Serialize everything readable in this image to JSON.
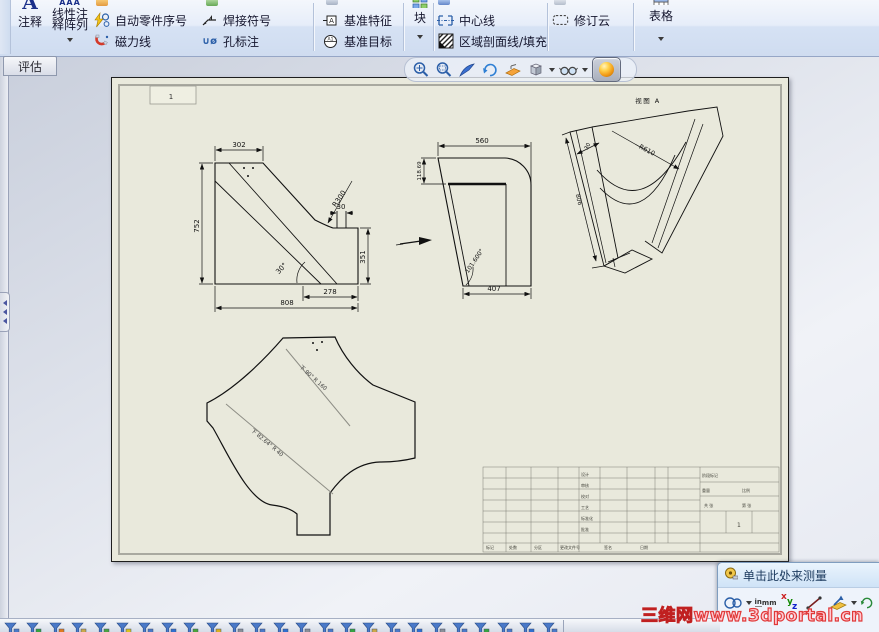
{
  "ribbon": {
    "note_icon_letter": "A",
    "note": "注释",
    "linear_note_icon": "AAA",
    "linear_note_line1": "线性注",
    "linear_note_line2": "释阵列",
    "auto_balloon": "自动零件序号",
    "magnetic_line": "磁力线",
    "weld_symbol": "焊接符号",
    "hole_icon": "∪ø",
    "hole_callout": "孔标注",
    "datum_feature": "基准特征",
    "datum_feature_letter": "A",
    "datum_target": "基准目标",
    "datum_target_letters": "A1",
    "block": "块",
    "centerline": "中心线",
    "area_hatch": "区域剖面线/填充",
    "revision_cloud": "修订云",
    "table": "表格"
  },
  "tab": {
    "evaluate": "评估"
  },
  "drawing": {
    "zone_label": "1",
    "front_view": {
      "dim_top": "302",
      "dim_left": "752",
      "dim_radius": "R300",
      "dim_tab": "30",
      "dim_right": "351",
      "dim_angle": "30°",
      "dim_bottom_inner": "278",
      "dim_bottom": "808"
    },
    "side_view": {
      "dim_top": "560",
      "dim_left": "118.69",
      "dim_angle": "101.600°",
      "dim_bottom": "407"
    },
    "iso_view": {
      "label": "视图 A",
      "dim_width": "30",
      "dim_radius": "R610",
      "dim_length": "806"
    },
    "flat_view": {
      "bend_note_upper": "下 90° R 160",
      "bend_note_lower": "下 82.64° R 40"
    }
  },
  "title_block": {
    "c_design": "设计",
    "c_check": "审核",
    "c_proof": "校对",
    "c_process": "工艺",
    "c_standard": "标准化",
    "c_approve": "批准",
    "c_stage": "阶段标记",
    "c_weight": "重量",
    "c_scale": "比例",
    "c_total": "共 张",
    "c_page": "第 张",
    "c_mark": "标记",
    "c_count": "处数",
    "c_zone": "分区",
    "c_docno": "更改文件号",
    "c_sign": "签名",
    "c_date": "日期",
    "sheet_no": "1"
  },
  "measure_panel": {
    "title": "单击此处来测量",
    "unit_top": "in",
    "unit_bottom": "mm",
    "axis_x": "x",
    "axis_y": "y",
    "axis_z": "z"
  },
  "watermark": {
    "part1": "三维网",
    "part2": "www.3dportal.cn"
  },
  "taskbar": {
    "icon_colors": [
      "#4a79c8",
      "#35a33f",
      "#e07a1f",
      "#c9a84a",
      "#4aa33f",
      "#d8c31f",
      "#4a79c8",
      "#2f6fd0",
      "#49a339",
      "#d8b021",
      "#8a8f98",
      "#4a79c8",
      "#2f6fd0",
      "#8a8f98",
      "#4a79c8",
      "#35a33f",
      "#c9a84a",
      "#4a79c8",
      "#2f6fd0",
      "#8a8f98",
      "#4a79c8",
      "#35a33f",
      "#4a79c8",
      "#2f6fd0",
      "#4a79c8"
    ]
  }
}
